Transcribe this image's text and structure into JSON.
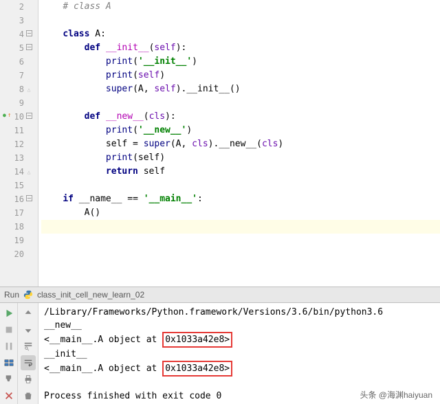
{
  "editor": {
    "lines": [
      {
        "n": 2,
        "indent": 1,
        "tokens": [
          [
            "# class A",
            "c-comment"
          ]
        ]
      },
      {
        "n": 3,
        "indent": 0,
        "tokens": []
      },
      {
        "n": 4,
        "indent": 1,
        "fold": true,
        "tokens": [
          [
            "class ",
            "c-kw"
          ],
          [
            "A",
            "c-ident"
          ],
          [
            ":",
            "c-op"
          ]
        ]
      },
      {
        "n": 5,
        "indent": 2,
        "fold": true,
        "tokens": [
          [
            "def ",
            "c-def"
          ],
          [
            "__init__",
            "c-fn"
          ],
          [
            "(",
            "c-op"
          ],
          [
            "self",
            "c-param"
          ],
          [
            "):",
            "c-op"
          ]
        ]
      },
      {
        "n": 6,
        "indent": 3,
        "tokens": [
          [
            "print",
            "c-builtin"
          ],
          [
            "(",
            "c-op"
          ],
          [
            "'__init__'",
            "c-str"
          ],
          [
            ")",
            "c-op"
          ]
        ]
      },
      {
        "n": 7,
        "indent": 3,
        "tokens": [
          [
            "print",
            "c-builtin"
          ],
          [
            "(",
            "c-op"
          ],
          [
            "self",
            "c-param"
          ],
          [
            ")",
            "c-op"
          ]
        ]
      },
      {
        "n": 8,
        "indent": 3,
        "foldend": true,
        "tokens": [
          [
            "super",
            "c-builtin"
          ],
          [
            "(A, ",
            "c-op"
          ],
          [
            "self",
            "c-param"
          ],
          [
            ").",
            "c-op"
          ],
          [
            "__init__",
            "c-ident"
          ],
          [
            "()",
            "c-op"
          ]
        ]
      },
      {
        "n": 9,
        "indent": 0,
        "tokens": []
      },
      {
        "n": 10,
        "indent": 2,
        "fold": true,
        "run": true,
        "tokens": [
          [
            "def ",
            "c-def"
          ],
          [
            "__new__",
            "c-fn"
          ],
          [
            "(",
            "c-op"
          ],
          [
            "cls",
            "c-param"
          ],
          [
            "):",
            "c-op"
          ]
        ]
      },
      {
        "n": 11,
        "indent": 3,
        "tokens": [
          [
            "print",
            "c-builtin"
          ],
          [
            "(",
            "c-op"
          ],
          [
            "'__new__'",
            "c-str"
          ],
          [
            ")",
            "c-op"
          ]
        ]
      },
      {
        "n": 12,
        "indent": 3,
        "tokens": [
          [
            "self = ",
            "c-ident"
          ],
          [
            "super",
            "c-builtin"
          ],
          [
            "(A, ",
            "c-op"
          ],
          [
            "cls",
            "c-param"
          ],
          [
            ").",
            "c-op"
          ],
          [
            "__new__",
            "c-ident"
          ],
          [
            "(",
            "c-op"
          ],
          [
            "cls",
            "c-param"
          ],
          [
            ")",
            "c-op"
          ]
        ]
      },
      {
        "n": 13,
        "indent": 3,
        "tokens": [
          [
            "print",
            "c-builtin"
          ],
          [
            "(self)",
            "c-op"
          ]
        ]
      },
      {
        "n": 14,
        "indent": 3,
        "foldend": true,
        "tokens": [
          [
            "return ",
            "c-kw"
          ],
          [
            "self",
            "c-ident"
          ]
        ]
      },
      {
        "n": 15,
        "indent": 0,
        "tokens": []
      },
      {
        "n": 16,
        "indent": 1,
        "fold": true,
        "tokens": [
          [
            "if ",
            "c-kw"
          ],
          [
            "__name__ == ",
            "c-ident"
          ],
          [
            "'__main__'",
            "c-str"
          ],
          [
            ":",
            "c-op"
          ]
        ]
      },
      {
        "n": 17,
        "indent": 2,
        "tokens": [
          [
            "A()",
            "c-ident"
          ]
        ]
      },
      {
        "n": 18,
        "indent": 0,
        "hl": true,
        "tokens": []
      },
      {
        "n": 19,
        "indent": 0,
        "tokens": []
      },
      {
        "n": 20,
        "indent": 0,
        "tokens": []
      }
    ],
    "indent_unit": "    "
  },
  "run_tool": {
    "label": "Run",
    "file": "class_init_cell_new_learn_02"
  },
  "console": {
    "lines": [
      {
        "type": "plain",
        "text": "/Library/Frameworks/Python.framework/Versions/3.6/bin/python3.6 "
      },
      {
        "type": "plain",
        "text": "__new__"
      },
      {
        "type": "addr",
        "prefix": "<__main__.A object at ",
        "addr": "0x1033a42e8>"
      },
      {
        "type": "plain",
        "text": "__init__"
      },
      {
        "type": "addr",
        "prefix": "<__main__.A object at ",
        "addr": "0x1033a42e8>"
      },
      {
        "type": "plain",
        "text": ""
      },
      {
        "type": "plain",
        "text": "Process finished with exit code 0"
      }
    ]
  },
  "watermark": "头条 @海渊haiyuan",
  "icons": {
    "fold_open": "⌄",
    "fold_close": "⌃"
  }
}
